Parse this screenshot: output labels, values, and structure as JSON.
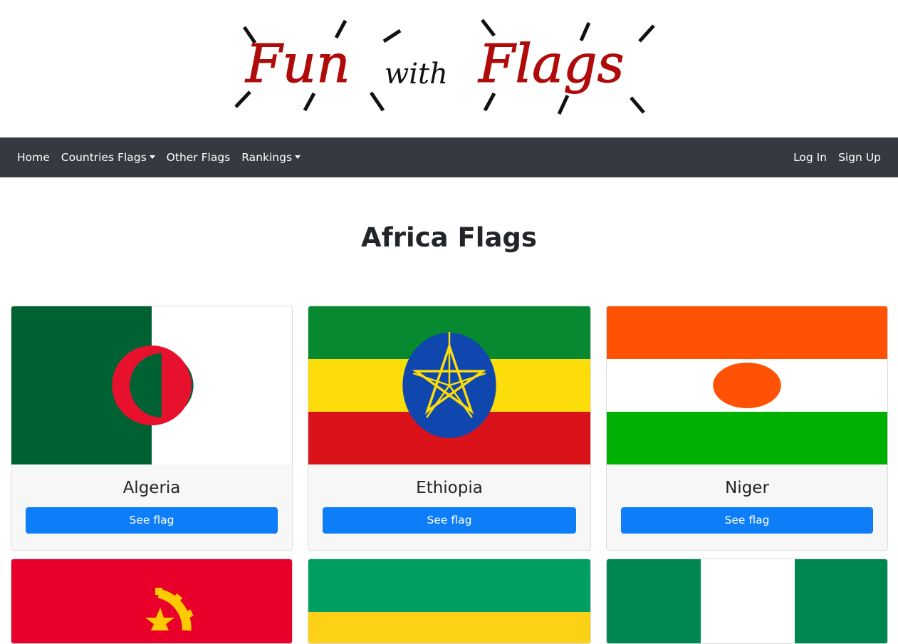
{
  "logo": {
    "word1": "Fun",
    "word2": "with",
    "word3": "Flags",
    "red": "#b00b0b"
  },
  "nav": {
    "left": [
      {
        "label": "Home"
      },
      {
        "label": "Countries Flags",
        "dropdown": true
      },
      {
        "label": "Other Flags"
      },
      {
        "label": "Rankings",
        "dropdown": true
      }
    ],
    "right": [
      {
        "label": "Log In"
      },
      {
        "label": "Sign Up"
      }
    ]
  },
  "page": {
    "title": "Africa Flags"
  },
  "cards": [
    {
      "name": "Algeria",
      "button": "See flag"
    },
    {
      "name": "Ethiopia",
      "button": "See flag"
    },
    {
      "name": "Niger",
      "button": "See flag"
    }
  ],
  "colors": {
    "navbar": "#343a40",
    "button": "#0d7ef8"
  }
}
